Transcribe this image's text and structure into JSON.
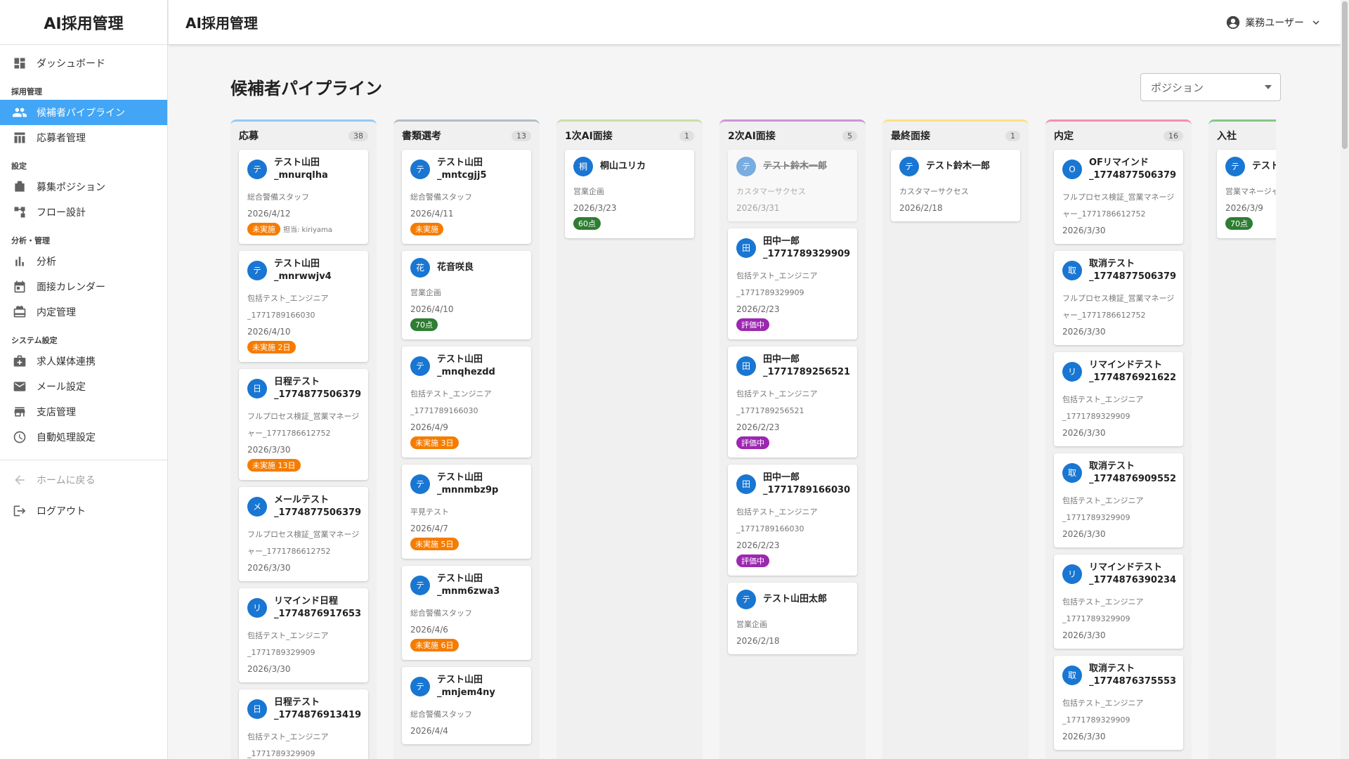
{
  "app": {
    "brand": "AI採用管理",
    "header_title": "AI採用管理",
    "user": "業務ユーザー"
  },
  "sidebar": {
    "dashboard": "ダッシュボード",
    "sec_recruit": "採用管理",
    "pipeline": "候補者パイプライン",
    "applicants": "応募者管理",
    "sec_settings": "設定",
    "positions": "募集ポジション",
    "flow": "フロー設計",
    "sec_analysis": "分析・管理",
    "analysis": "分析",
    "calendar": "面接カレンダー",
    "offers": "内定管理",
    "sec_system": "システム設定",
    "media": "求人媒体連携",
    "mail": "メール設定",
    "branch": "支店管理",
    "auto": "自動処理設定",
    "home": "ホームに戻る",
    "logout": "ログアウト"
  },
  "page": {
    "title": "候補者パイプライン",
    "position_select": "ポジション"
  },
  "columns": [
    {
      "title": "応募",
      "count": "38",
      "color": "#90caf9",
      "cards": [
        {
          "avatar": "テ",
          "name": "テスト山田_mnurqlha",
          "pos": "総合警備スタッフ",
          "date": "2026/4/12",
          "badge": "未実施",
          "badge_color": "#f57c00",
          "assignee": "担当: kiriyama"
        },
        {
          "avatar": "テ",
          "name": "テスト山田_mnrwwjv4",
          "pos": "包括テスト_エンジニア_1771789166030",
          "date": "2026/4/10",
          "badge": "未実施 2日",
          "badge_color": "#f57c00"
        },
        {
          "avatar": "日",
          "name": "日程テスト_1774877506379",
          "pos": "フルプロセス検証_営業マネージャー_1771786612752",
          "date": "2026/3/30",
          "badge": "未実施 13日",
          "badge_color": "#f57c00"
        },
        {
          "avatar": "メ",
          "name": "メールテスト_1774877506379",
          "pos": "フルプロセス検証_営業マネージャー_1771786612752",
          "date": "2026/3/30"
        },
        {
          "avatar": "リ",
          "name": "リマインド日程_1774876917653",
          "pos": "包括テスト_エンジニア_1771789329909",
          "date": "2026/3/30"
        },
        {
          "avatar": "日",
          "name": "日程テスト_1774876913419",
          "pos": "包括テスト_エンジニア_1771789329909",
          "date": ""
        }
      ]
    },
    {
      "title": "書類選考",
      "count": "13",
      "color": "#b0bec5",
      "cards": [
        {
          "avatar": "テ",
          "name": "テスト山田_mntcgjj5",
          "pos": "総合警備スタッフ",
          "date": "2026/4/11",
          "badge": "未実施",
          "badge_color": "#f57c00"
        },
        {
          "avatar": "花",
          "name": "花音咲良",
          "pos": "営業企画",
          "date": "2026/4/10",
          "badge": "70点",
          "badge_color": "#2e7d32"
        },
        {
          "avatar": "テ",
          "name": "テスト山田_mnqhezdd",
          "pos": "包括テスト_エンジニア_1771789166030",
          "date": "2026/4/9",
          "badge": "未実施 3日",
          "badge_color": "#f57c00"
        },
        {
          "avatar": "テ",
          "name": "テスト山田_mnnmbz9p",
          "pos": "平見テスト",
          "date": "2026/4/7",
          "badge": "未実施 5日",
          "badge_color": "#f57c00"
        },
        {
          "avatar": "テ",
          "name": "テスト山田_mnm6zwa3",
          "pos": "総合警備スタッフ",
          "date": "2026/4/6",
          "badge": "未実施 6日",
          "badge_color": "#f57c00"
        },
        {
          "avatar": "テ",
          "name": "テスト山田_mnjem4ny",
          "pos": "総合警備スタッフ",
          "date": "2026/4/4"
        }
      ]
    },
    {
      "title": "1次AI面接",
      "count": "1",
      "color": "#c5e1a5",
      "cards": [
        {
          "avatar": "桐",
          "name": "桐山ユリカ",
          "pos": "営業企画",
          "date": "2026/3/23",
          "badge": "60点",
          "badge_color": "#2e7d32"
        }
      ]
    },
    {
      "title": "2次AI面接",
      "count": "5",
      "color": "#ce93d8",
      "cards": [
        {
          "avatar": "テ",
          "name": "テスト鈴木一郎",
          "pos": "カスタマーサクセス",
          "date": "2026/3/31",
          "faded": true
        },
        {
          "avatar": "田",
          "name": "田中一郎_1771789329909",
          "pos": "包括テスト_エンジニア_1771789329909",
          "date": "2026/2/23",
          "badge": "評価中",
          "badge_color": "#9c27b0"
        },
        {
          "avatar": "田",
          "name": "田中一郎_1771789256521",
          "pos": "包括テスト_エンジニア_1771789256521",
          "date": "2026/2/23",
          "badge": "評価中",
          "badge_color": "#9c27b0"
        },
        {
          "avatar": "田",
          "name": "田中一郎_1771789166030",
          "pos": "包括テスト_エンジニア_1771789166030",
          "date": "2026/2/23",
          "badge": "評価中",
          "badge_color": "#9c27b0"
        },
        {
          "avatar": "テ",
          "name": "テスト山田太郎",
          "pos": "営業企画",
          "date": "2026/2/18"
        }
      ]
    },
    {
      "title": "最終面接",
      "count": "1",
      "color": "#ffe082",
      "cards": [
        {
          "avatar": "テ",
          "name": "テスト鈴木一郎",
          "pos": "カスタマーサクセス",
          "date": "2026/2/18"
        }
      ]
    },
    {
      "title": "内定",
      "count": "16",
      "color": "#f48fb1",
      "cards": [
        {
          "avatar": "O",
          "name": "OFリマインド_1774877506379",
          "pos": "フルプロセス検証_営業マネージャー_1771786612752",
          "date": "2026/3/30"
        },
        {
          "avatar": "取",
          "name": "取消テスト_1774877506379",
          "pos": "フルプロセス検証_営業マネージャー_1771786612752",
          "date": "2026/3/30"
        },
        {
          "avatar": "リ",
          "name": "リマインドテスト_1774876921622",
          "pos": "包括テスト_エンジニア_1771789329909",
          "date": "2026/3/30"
        },
        {
          "avatar": "取",
          "name": "取消テスト_1774876909552",
          "pos": "包括テスト_エンジニア_1771789329909",
          "date": "2026/3/30"
        },
        {
          "avatar": "リ",
          "name": "リマインドテスト_1774876390234",
          "pos": "包括テスト_エンジニア_1771789329909",
          "date": "2026/3/30"
        },
        {
          "avatar": "取",
          "name": "取消テスト_1774876375553",
          "pos": "包括テスト_エンジニア_1771789329909",
          "date": "2026/3/30"
        }
      ]
    },
    {
      "title": "入社",
      "count": "",
      "color": "#81c784",
      "cards": [
        {
          "avatar": "テ",
          "name": "テスト",
          "pos": "営業マネージャ",
          "date": "2026/3/9",
          "badge": "70点",
          "badge_color": "#2e7d32"
        }
      ]
    }
  ]
}
